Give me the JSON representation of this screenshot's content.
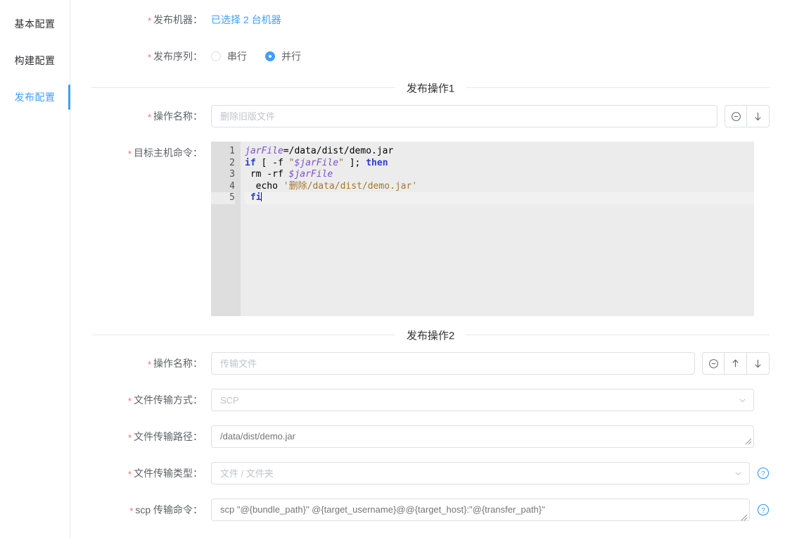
{
  "sidebar": {
    "items": [
      {
        "label": "基本配置",
        "active": false
      },
      {
        "label": "构建配置",
        "active": false
      },
      {
        "label": "发布配置",
        "active": true
      }
    ]
  },
  "form": {
    "publish_machine": {
      "label": "发布机器",
      "required": true,
      "link_text": "已选择 2 台机器"
    },
    "publish_sequence": {
      "label": "发布序列",
      "required": true,
      "options": [
        {
          "label": "串行",
          "selected": false
        },
        {
          "label": "并行",
          "selected": true
        }
      ]
    }
  },
  "sections": [
    {
      "title": "发布操作1",
      "op_name": {
        "label": "操作名称",
        "required": true,
        "value": "",
        "placeholder": "删除旧版文件"
      },
      "target_cmd": {
        "label": "目标主机命令",
        "required": true
      },
      "buttons": [
        {
          "name": "remove-operation-button",
          "icon": "minus-circle-icon"
        },
        {
          "name": "move-down-button",
          "icon": "arrow-down-icon"
        }
      ],
      "code": {
        "lines": [
          {
            "num": "1",
            "active": false,
            "tokens": [
              {
                "t": "jarFile",
                "c": "tk-var"
              },
              {
                "t": "=/data/dist/demo.jar",
                "c": "tk-txt"
              }
            ]
          },
          {
            "num": "2",
            "active": false,
            "tokens": [
              {
                "t": "if",
                "c": "tk-kw"
              },
              {
                "t": " [ -f ",
                "c": "tk-txt"
              },
              {
                "t": "\"",
                "c": "tk-str"
              },
              {
                "t": "$jarFile",
                "c": "tk-var"
              },
              {
                "t": "\"",
                "c": "tk-str"
              },
              {
                "t": " ]; ",
                "c": "tk-txt"
              },
              {
                "t": "then",
                "c": "tk-kw"
              }
            ]
          },
          {
            "num": "3",
            "active": false,
            "tokens": [
              {
                "t": " rm -rf ",
                "c": "tk-txt"
              },
              {
                "t": "$jarFile",
                "c": "tk-var"
              }
            ]
          },
          {
            "num": "4",
            "active": false,
            "tokens": [
              {
                "t": "  echo ",
                "c": "tk-txt"
              },
              {
                "t": "'删除/data/dist/demo.jar'",
                "c": "tk-str"
              }
            ]
          },
          {
            "num": "5",
            "active": true,
            "tokens": [
              {
                "t": " fi",
                "c": "tk-kw"
              }
            ]
          }
        ]
      }
    },
    {
      "title": "发布操作2",
      "op_name": {
        "label": "操作名称",
        "required": true,
        "value": "",
        "placeholder": "传输文件"
      },
      "buttons": [
        {
          "name": "remove-operation-button",
          "icon": "minus-circle-icon"
        },
        {
          "name": "move-up-button",
          "icon": "arrow-up-icon"
        },
        {
          "name": "move-down-button",
          "icon": "arrow-down-icon"
        }
      ],
      "transfer_mode": {
        "label": "文件传输方式",
        "required": true,
        "value": "SCP",
        "placeholder": "SCP"
      },
      "transfer_path": {
        "label": "文件传输路径",
        "required": true,
        "value": "",
        "placeholder": "/data/dist/demo.jar"
      },
      "transfer_type": {
        "label": "文件传输类型",
        "required": true,
        "value": "",
        "placeholder": "文件 / 文件夹"
      },
      "scp_cmd": {
        "label": "scp 传输命令",
        "required": true,
        "value": "",
        "placeholder": "scp \"@{bundle_path}\" @{target_username}@@{target_host}:\"@{transfer_path}\""
      }
    }
  ],
  "colors": {
    "accent": "#409eff",
    "required": "#f56c6c",
    "border": "#dcdfe6",
    "editor_bg": "#ececec",
    "gutter_bg": "#dedede"
  }
}
